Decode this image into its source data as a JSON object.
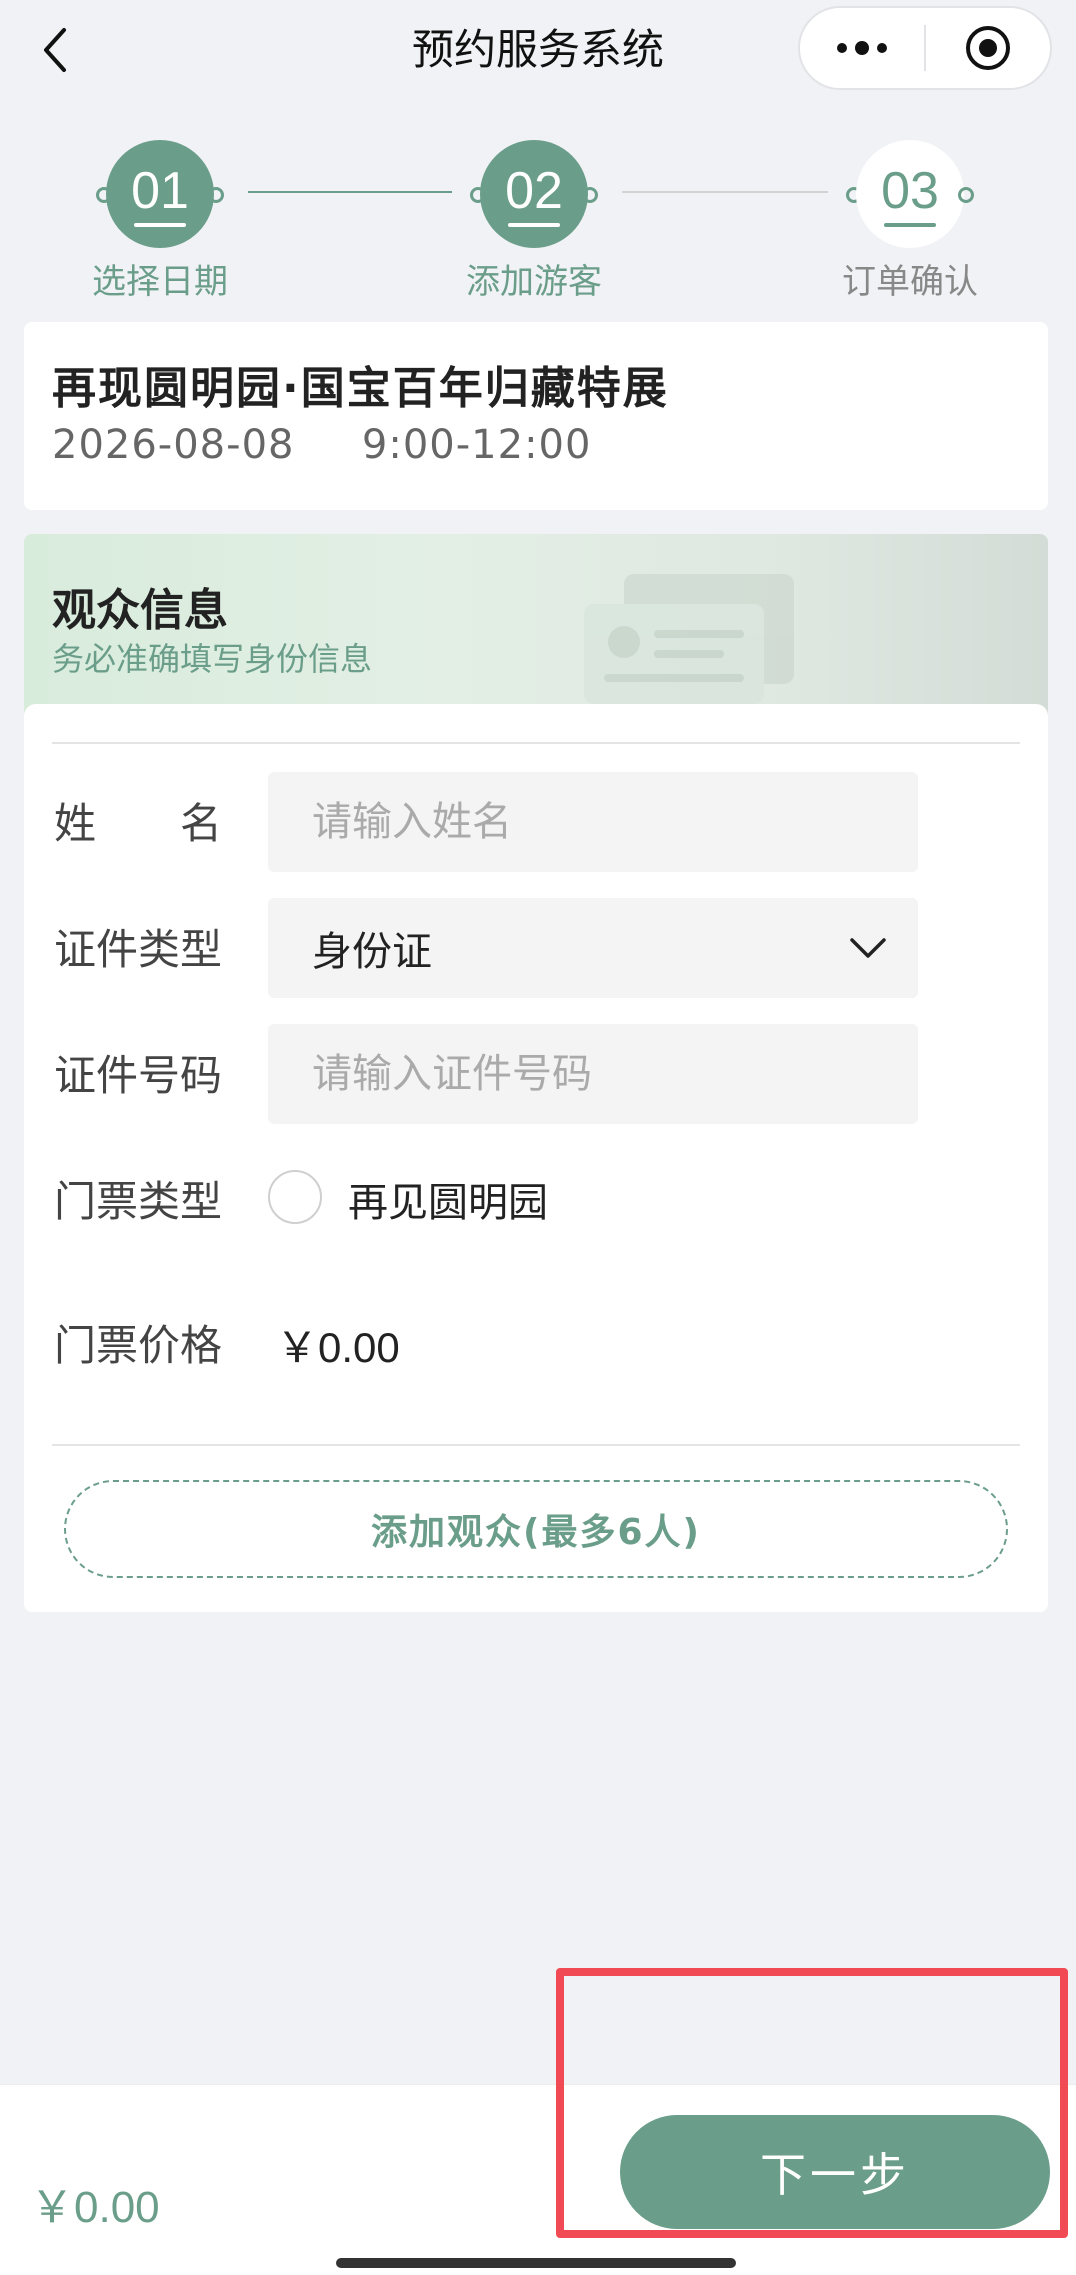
{
  "nav": {
    "title": "预约服务系统",
    "icons": [
      "back-icon",
      "more-icon",
      "close-mini-program-icon"
    ]
  },
  "stepper": {
    "steps": [
      {
        "num": "01",
        "label": "选择日期",
        "state": "done"
      },
      {
        "num": "02",
        "label": "添加游客",
        "state": "current"
      },
      {
        "num": "03",
        "label": "订单确认",
        "state": "pending"
      }
    ]
  },
  "event": {
    "title": "再现圆明园·国宝百年归藏特展",
    "date": "2026-08-08",
    "time": "9:00-12:00"
  },
  "visitor": {
    "title": "观众信息",
    "subtitle": "务必准确填写身份信息",
    "name_label": "姓　　名",
    "name_placeholder": "请输入姓名",
    "id_type_label": "证件类型",
    "id_type_value": "身份证",
    "id_number_label": "证件号码",
    "id_number_placeholder": "请输入证件号码",
    "ticket_type_label": "门票类型",
    "ticket_option": "再见圆明园",
    "price_label": "门票价格",
    "price_value": "￥0.00",
    "add_button": "添加观众(最多6人)"
  },
  "bottom": {
    "total": "￥0.00",
    "next_button": "下一步"
  },
  "colors": {
    "accent": "#6b9e8a",
    "highlight": "#f24a55",
    "background": "#f1f2f5"
  }
}
